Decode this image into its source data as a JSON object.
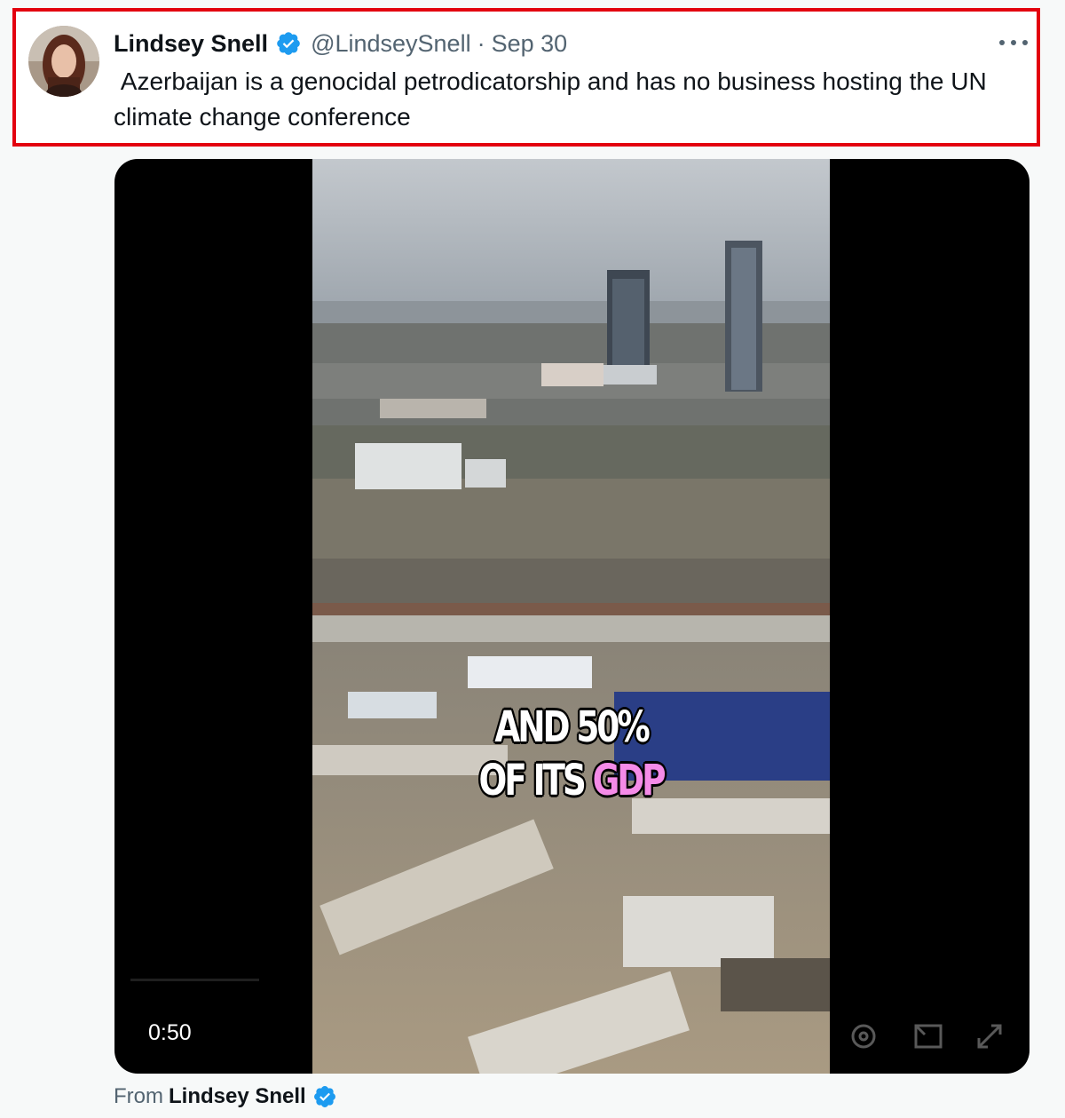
{
  "tweet": {
    "display_name": "Lindsey Snell",
    "handle": "@LindseySnell",
    "separator": "·",
    "date": "Sep 30",
    "text": " Azerbaijan is a genocidal petrodicatorship and has no business hosting the UN climate change conference",
    "verified": true
  },
  "video": {
    "caption_line1": "AND 50%",
    "caption_line2_white": "OF ITS ",
    "caption_line2_pink": "GDP",
    "duration": "0:50"
  },
  "footer": {
    "from_label": "From",
    "from_name": "Lindsey Snell"
  },
  "colors": {
    "highlight_border": "#e3000f",
    "verified_blue": "#1d9bf0",
    "caption_pink": "#f58be8",
    "text_primary": "#0f1419",
    "text_secondary": "#536471"
  }
}
